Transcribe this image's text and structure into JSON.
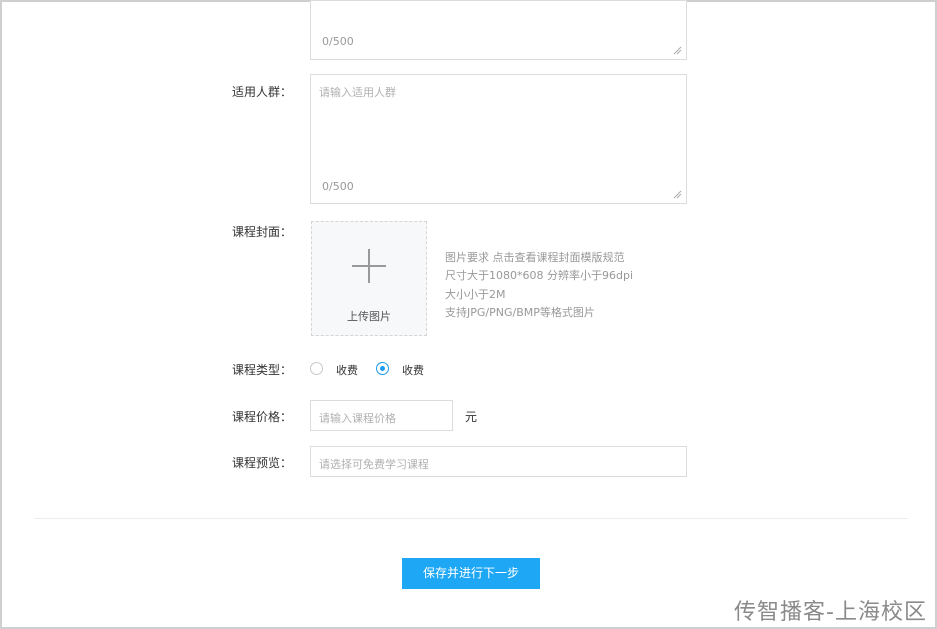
{
  "top_textarea": {
    "counter": "0/500"
  },
  "audience": {
    "label": "适用人群：",
    "placeholder": "请输入适用人群",
    "counter": "0/500"
  },
  "cover": {
    "label": "课程封面：",
    "upload_text": "上传图片",
    "requirements": [
      "图片要求 点击查看课程封面模版规范",
      "尺寸大于1080*608 分辨率小于96dpi",
      "大小小于2M",
      "支持JPG/PNG/BMP等格式图片"
    ]
  },
  "course_type": {
    "label": "课程类型：",
    "options": [
      {
        "label": "收费",
        "checked": false
      },
      {
        "label": "收费",
        "checked": true
      }
    ]
  },
  "price": {
    "label": "课程价格：",
    "placeholder": "请输入课程价格",
    "unit": "元"
  },
  "preview": {
    "label": "课程预览：",
    "placeholder": "请选择可免费学习课程"
  },
  "submit_label": "保存并进行下一步",
  "watermark": "传智播客-上海校区",
  "colors": {
    "accent": "#1ea7f5",
    "border": "#dcdcdc"
  }
}
